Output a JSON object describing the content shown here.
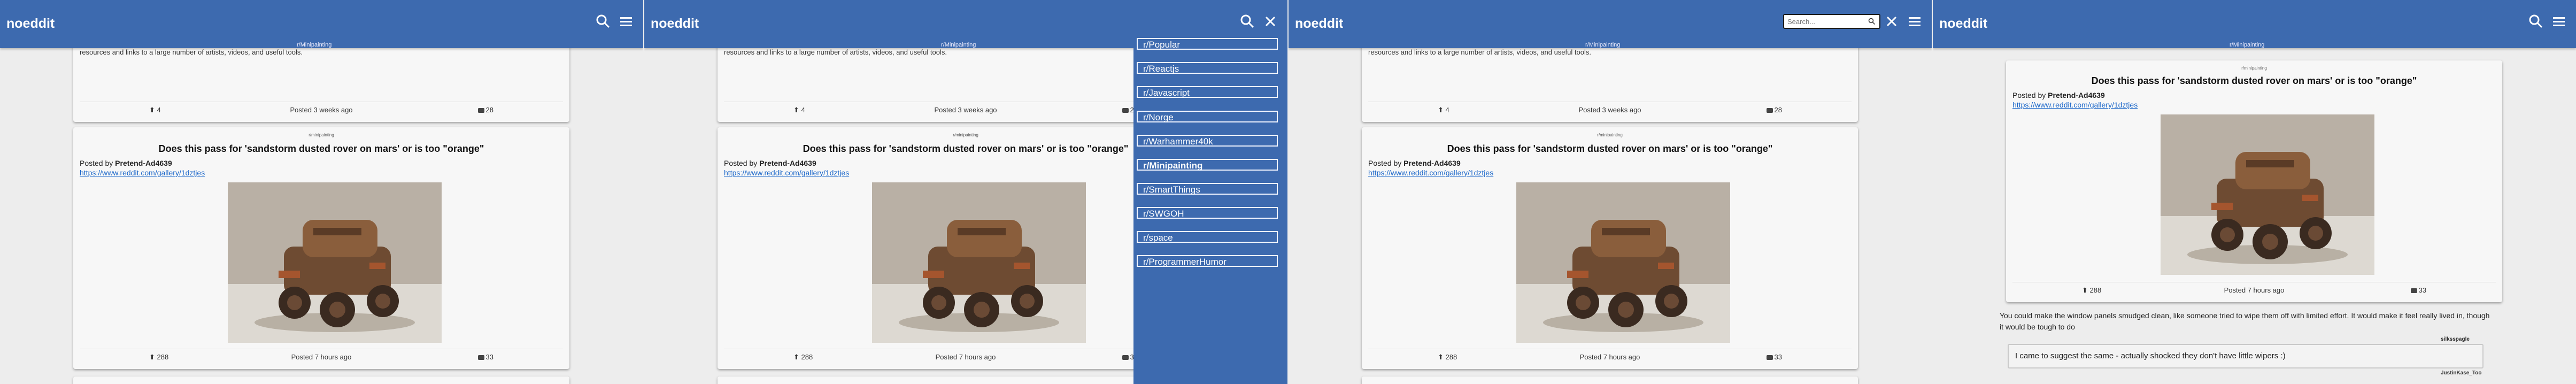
{
  "app": {
    "brand": "noeddit",
    "subreddit_tag": "r/Minipainting"
  },
  "prev_post": {
    "preview": "resources and links to a large number of artists, videos, and useful tools.",
    "votes": "4",
    "posted": "Posted 3 weeks ago",
    "comments": "28"
  },
  "post": {
    "sub": "r/minipainting",
    "title": "Does this pass for 'sandstorm dusted rover on mars' or is too \"orange\"",
    "posted_by_prefix": "Posted by",
    "author": "Pretend-Ad4639",
    "url": "https://www.reddit.com/gallery/1dztjes",
    "votes": "288",
    "posted": "Posted 7 hours ago",
    "comments": "33",
    "image_alt": "Painted miniature rover"
  },
  "sidebar": {
    "items": [
      {
        "label": "r/Popular"
      },
      {
        "label": "r/Reactjs"
      },
      {
        "label": "r/Javascript"
      },
      {
        "label": "r/Norge"
      },
      {
        "label": "r/Warhammer40k"
      },
      {
        "label": "r/Minipainting"
      },
      {
        "label": "r/SmartThings"
      },
      {
        "label": "r/SWGOH"
      },
      {
        "label": "r/space"
      },
      {
        "label": "r/ProgrammerHumor"
      }
    ]
  },
  "search": {
    "placeholder": "Search..."
  },
  "comments": {
    "first": {
      "author": "silksspagle",
      "text": "You could make the window panels smudged clean, like someone tried to wipe them off with limited effort. It would make it feel really lived in, though it would be tough to do"
    },
    "reply": {
      "author": "JustinKase_Too",
      "text": "I came to suggest the same - actually shocked they don't have little wipers :)"
    }
  }
}
